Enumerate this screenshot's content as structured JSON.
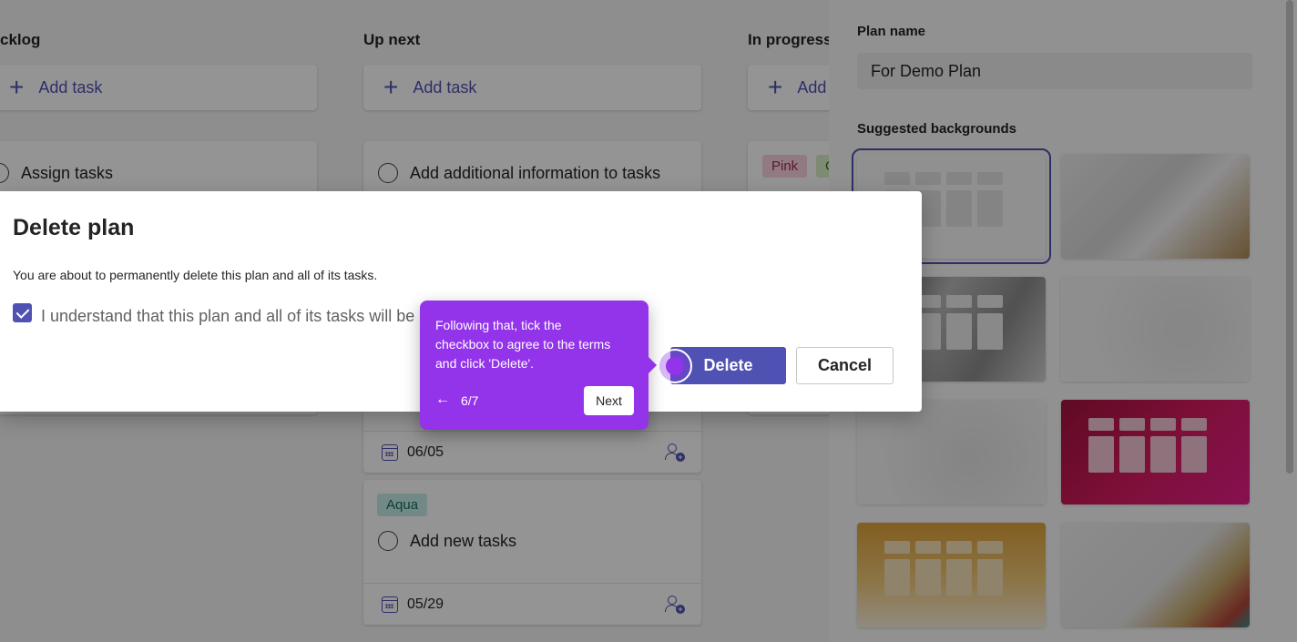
{
  "board": {
    "columns": [
      {
        "title": "cklog",
        "add_label": "Add task"
      },
      {
        "title": "Up next",
        "add_label": "Add task"
      },
      {
        "title": "In progress",
        "add_label": "Add"
      }
    ],
    "tasks": {
      "backlog_first": "Assign tasks",
      "upnext_first": "Add additional information to tasks",
      "upnext_hidden_date": "06/05",
      "upnext_second_tag": "Aqua",
      "upnext_second": "Add new tasks",
      "upnext_second_date": "05/29",
      "inprogress_tags": [
        "Pink",
        "G"
      ]
    }
  },
  "panel": {
    "plan_name_label": "Plan name",
    "plan_name_value": "For Demo Plan",
    "backgrounds_label": "Suggested backgrounds"
  },
  "dialog": {
    "title": "Delete plan",
    "description": "You are about to permanently delete this plan and all of its tasks.",
    "checkbox_label": "I understand that this plan and all of its tasks will be",
    "checkbox_checked": true,
    "delete_label": "Delete",
    "cancel_label": "Cancel"
  },
  "tooltip": {
    "text": "Following that, tick the checkbox to agree to the terms and click 'Delete'.",
    "back_icon": "←",
    "step": "6/7",
    "next_label": "Next"
  },
  "colors": {
    "accent": "#4f52b2",
    "tooltip": "#9333ea"
  }
}
